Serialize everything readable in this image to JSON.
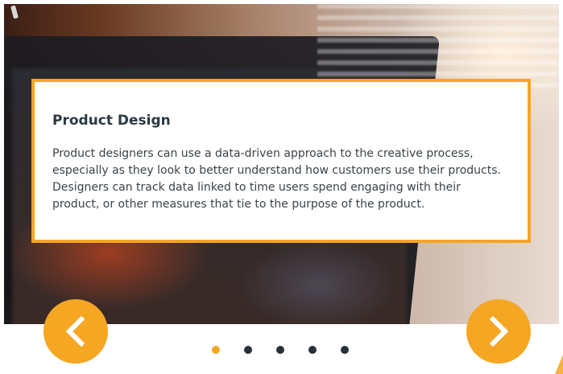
{
  "slide": {
    "title": "Product Design",
    "body": "Product designers can use a data-driven approach to the creative process, especially as they look to better understand how customers use their products. Designers can track data linked to time users spend engaging with their product, or other measures that tie to the purpose of the product."
  },
  "controls": {
    "prev_icon": "chevron-left-icon",
    "next_icon": "chevron-right-icon",
    "dots": [
      {
        "active": true
      },
      {
        "active": false
      },
      {
        "active": false
      },
      {
        "active": false
      },
      {
        "active": false
      }
    ],
    "active_index": 1
  },
  "colors": {
    "accent": "#f5a623",
    "dot_inactive": "#24323a",
    "title": "#2b3a42",
    "body": "#3a4349"
  }
}
